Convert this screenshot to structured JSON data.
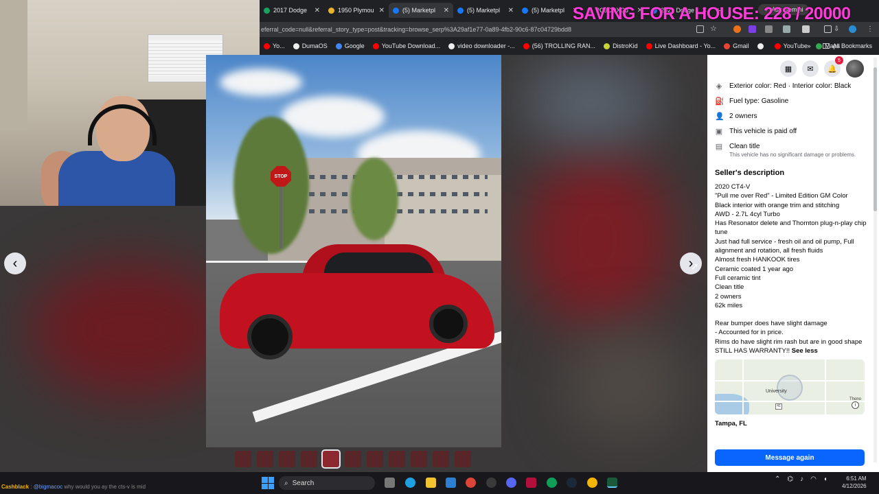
{
  "overlay": {
    "title": "SAVING FOR A HOUSE: 228 / 20000"
  },
  "browser": {
    "tabs": [
      {
        "label": "2017 Dodge",
        "color": "#1aa260",
        "active": false
      },
      {
        "label": "1950 Plymou",
        "color": "#e9b22f",
        "active": false
      },
      {
        "label": "(5) Marketpl",
        "color": "#1877f2",
        "active": true
      },
      {
        "label": "(5) Marketpl",
        "color": "#1877f2",
        "active": false
      },
      {
        "label": "(5) Marketpl",
        "color": "#1877f2",
        "active": false
      },
      {
        "label": "2C3CDXGJ",
        "color": "#4a4a4a",
        "active": false
      },
      {
        "label": "2021 Dodge",
        "color": "#2f6fd6",
        "active": false
      }
    ],
    "new_tab": "+",
    "gemini_label": "Ask Gemini",
    "url": "eferral_code=null&referral_story_type=post&tracking=browse_serp%3A29af1e77-0a89-4fb2-90c6-87c04729bdd8",
    "bookmarks": [
      {
        "label": "Yo...",
        "color": "#ff0000"
      },
      {
        "label": "DumaOS",
        "color": "#eeeeee"
      },
      {
        "label": "Google",
        "color": "#4285f4"
      },
      {
        "label": "YouTube Download...",
        "color": "#ff0000"
      },
      {
        "label": "video downloader -...",
        "color": "#eeeeee"
      },
      {
        "label": "(56) TROLLING RAN...",
        "color": "#ff0000"
      },
      {
        "label": "DistroKid",
        "color": "#c6d33a"
      },
      {
        "label": "Live Dashboard - Yo...",
        "color": "#ff0000"
      },
      {
        "label": "Gmail",
        "color": "#ea4335"
      },
      {
        "label": "",
        "color": "#eeeeee"
      },
      {
        "label": "YouTube",
        "color": "#ff0000"
      },
      {
        "label": "Maps",
        "color": "#34a853"
      }
    ],
    "bookmarks_more": "»",
    "all_bookmarks": "All Bookmarks"
  },
  "viewer": {
    "prev": "‹",
    "next": "›",
    "stop_sign": "STOP",
    "thumb_count": 11,
    "active_thumb": 4
  },
  "panel": {
    "notification_count": "5",
    "specs": [
      {
        "icon": "paint-icon",
        "glyph": "◈",
        "text": "Exterior color: Red · Interior color: Black",
        "sub": ""
      },
      {
        "icon": "fuel-icon",
        "glyph": "⛽",
        "text": "Fuel type: Gasoline",
        "sub": ""
      },
      {
        "icon": "owners-icon",
        "glyph": "👤",
        "text": "2 owners",
        "sub": ""
      },
      {
        "icon": "paid-icon",
        "glyph": "▣",
        "text": "This vehicle is paid off",
        "sub": ""
      },
      {
        "icon": "title-icon",
        "glyph": "▤",
        "text": "Clean title",
        "sub": "This vehicle has no significant damage or problems."
      }
    ],
    "description_heading": "Seller's description",
    "description_lines": [
      "2020 CT4-V",
      "\"Pull me over Red\" - Limited Edition GM Color",
      "Black interior with orange trim and stitching",
      "AWD - 2.7L 4cyl Turbo",
      "Has Resonator delete and Thornton plug-n-play chip tune",
      "Just had full service - fresh oil and oil pump, Full alignment and rotation, all fresh fluids",
      "Almost fresh HANKOOK tires",
      "Ceramic coated 1 year ago",
      "Full ceramic tint",
      "Clean title",
      "2 owners",
      "62k miles",
      "",
      "Rear bumper does have slight damage",
      "- Accounted for in price.",
      "Rims do have slight rim rash but are in good shape"
    ],
    "description_last": "STILL HAS WARRANTY!!",
    "see_less": "See less",
    "map_label_university": "University",
    "map_label_thono": "Thono",
    "map_shield": "41",
    "location": "Tampa, FL",
    "message_button": "Message again"
  },
  "chat": {
    "user": "Cashblack",
    "mention": "@bigmacoc",
    "message": "why would you ay the cts-v is mid"
  },
  "taskbar": {
    "search_placeholder": "Search",
    "time": "6:51 AM",
    "date": "4/12/2026"
  }
}
